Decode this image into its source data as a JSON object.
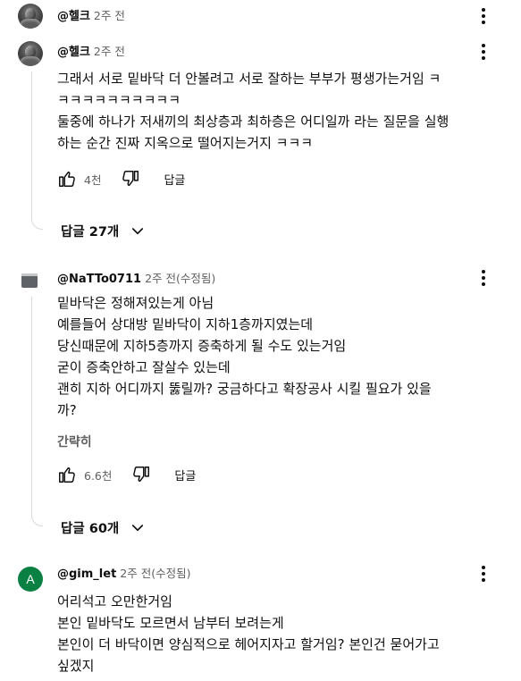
{
  "comments": [
    {
      "author": "@헬크",
      "meta": "2주 전"
    },
    {
      "author": "@헬크",
      "meta": "2주 전",
      "lines": [
        "그래서 서로 밑바닥 더 안볼려고 서로 잘하는 부부가 평생가는거임 ㅋ",
        "ㅋㅋㅋㅋㅋㅋㅋㅋㅋㅋ",
        "둘중에 하나가 저새끼의 최상층과 최하층은 어디일까 라는 질문을 실행",
        "하는 순간 진짜 지옥으로 떨어지는거지 ㅋㅋㅋ"
      ],
      "likes": "4천",
      "reply_label": "답글",
      "replies_label": "답글 27개"
    },
    {
      "author": "@NaTTo0711",
      "meta": "2주 전(수정됨)",
      "lines": [
        "밑바닥은 정해져있는게 아님",
        "예를들어 상대방 밑바닥이 지하1층까지였는데",
        "당신때문에 지하5층까지 증축하게 될 수도 있는거임",
        "굳이 증축안하고 잘살수 있는데",
        "괜히 지하 어디까지 뚫릴까? 궁금하다고 확장공사 시킬 필요가 있을",
        "까?"
      ],
      "more_label": "간략히",
      "likes": "6.6천",
      "reply_label": "답글",
      "replies_label": "답글 60개"
    },
    {
      "author": "@gim_let",
      "meta": "2주 전(수정됨)",
      "avatar_letter": "A",
      "lines": [
        "어리석고 오만한거임",
        "본인 밑바닥도 모르면서 남부터 보려는게",
        "본인이 더 바닥이면 양심적으로 헤어지자고 할거임? 본인건 묻어가고",
        "싶겠지"
      ]
    }
  ],
  "icons": {
    "like": "thumbs-up-icon",
    "dislike": "thumbs-down-icon",
    "menu": "more-vert-icon",
    "expand": "chevron-down-icon"
  },
  "colors": {
    "text": "#0f0f0f",
    "secondary": "#606060",
    "avatar_letter_bg": "#0b8043",
    "thread_line": "#d9d9d9"
  }
}
